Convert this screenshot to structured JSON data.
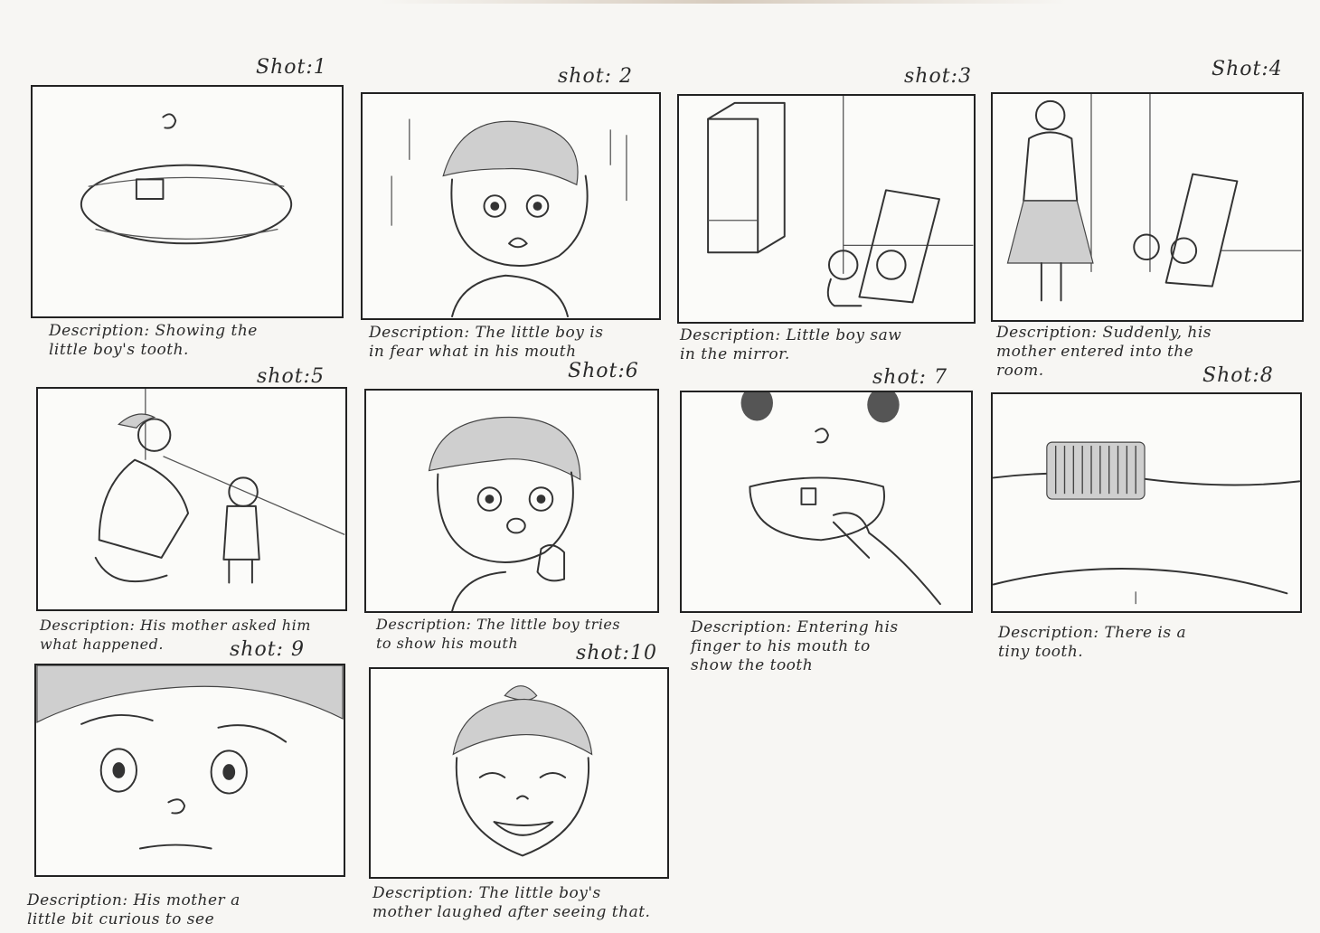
{
  "shots": [
    {
      "label": "Shot:1",
      "description": [
        "Description: Showing the",
        "little boy's tooth."
      ]
    },
    {
      "label": "shot: 2",
      "description": [
        "Description: The little boy is",
        "in fear what in his mouth"
      ]
    },
    {
      "label": "shot:3",
      "description": [
        "Description: Little boy saw",
        "in the mirror."
      ]
    },
    {
      "label": "Shot:4",
      "description": [
        "Description: Suddenly, his",
        "mother entered into the",
        "room."
      ]
    },
    {
      "label": "shot:5",
      "description": [
        "Description: His mother asked him",
        "what happened."
      ]
    },
    {
      "label": "Shot:6",
      "description": [
        "Description: The little boy tries",
        "to show his mouth"
      ]
    },
    {
      "label": "shot: 7",
      "description": [
        "Description: Entering his",
        "finger to his mouth to",
        "show the tooth"
      ]
    },
    {
      "label": "Shot:8",
      "description": [
        "Description: There is a",
        "tiny tooth."
      ]
    },
    {
      "label": "shot: 9",
      "description": [
        "Description: His mother a",
        "little bit curious to see"
      ]
    },
    {
      "label": "shot:10",
      "description": [
        "Description: The little boy's",
        "mother laughed after seeing that."
      ]
    }
  ]
}
